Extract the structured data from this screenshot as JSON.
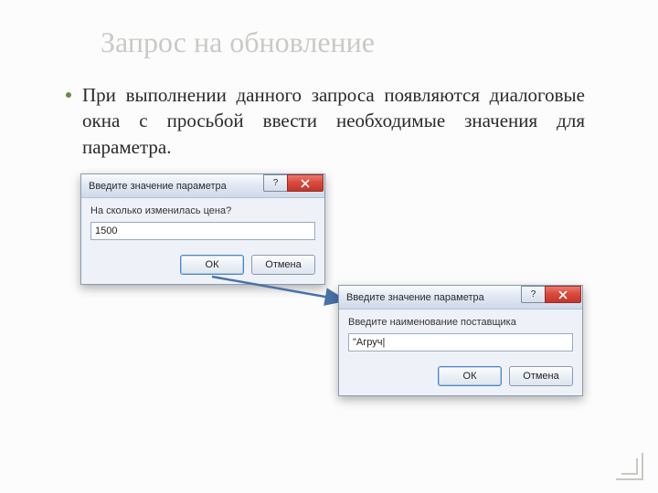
{
  "title": "Запрос на обновление",
  "body": "При выполнении данного запроса появляются диалоговые окна с просьбой ввести необходимые значения для параметра.",
  "dialog1": {
    "title": "Введите значение параметра",
    "help": "?",
    "prompt": "На сколько изменилась цена?",
    "value": "1500",
    "ok": "ОК",
    "cancel": "Отмена"
  },
  "dialog2": {
    "title": "Введите значение параметра",
    "help": "?",
    "prompt": "Введите наименование поставщика",
    "value": "\"Агруч|",
    "ok": "ОК",
    "cancel": "Отмена"
  }
}
